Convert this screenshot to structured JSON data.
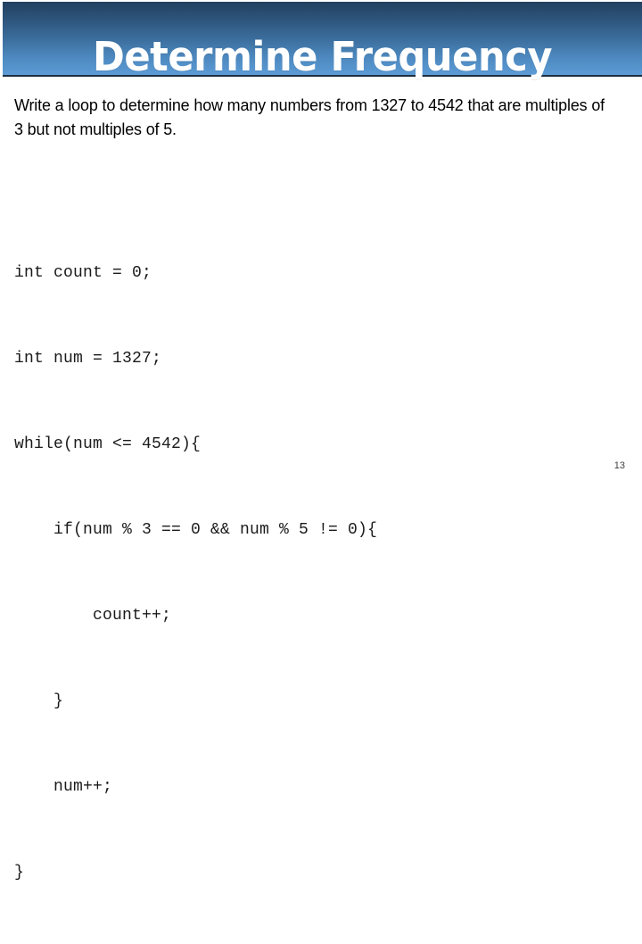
{
  "slide": {
    "title": "Determine Frequency",
    "body_paragraph": "Write a loop to determine how many numbers from 1327 to 4542 that are multiples of 3 but not multiples of 5.",
    "page_number": "13",
    "colors": {
      "banner_gradient_top": "#23415f",
      "banner_gradient_bottom": "#5c9bd6",
      "banner_border": "#1d2f3f",
      "title_text": "#ffffff",
      "body_text": "#000000",
      "code_text": "#1a1a1a",
      "page_number_text": "#3f3f3f",
      "background": "#ffffff"
    },
    "code": {
      "lines": [
        "int count = 0;",
        "int num = 1327;",
        "while(num <= 4542){",
        "    if(num % 3 == 0 && num % 5 != 0){",
        "        count++;",
        "    }",
        "    num++;",
        "}"
      ]
    }
  }
}
